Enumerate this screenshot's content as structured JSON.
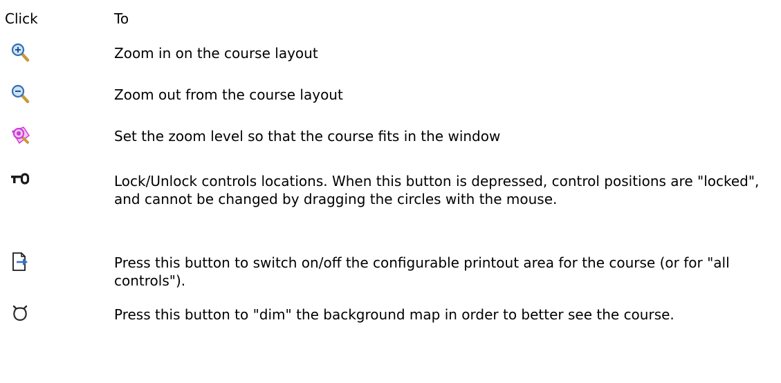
{
  "table": {
    "header_click": "Click",
    "header_to": "To"
  },
  "rows": [
    {
      "icon": "zoom-in-icon",
      "description": "Zoom in on the course layout"
    },
    {
      "icon": "zoom-out-icon",
      "description": "Zoom out from the course layout"
    },
    {
      "icon": "zoom-fit-icon",
      "description": "Set the zoom level so that the course fits in the window"
    },
    {
      "icon": "lock-controls-icon",
      "description": "Lock/Unlock controls locations.  When this button is depressed, control positions are \"locked\", and cannot be changed by dragging the circles with the mouse."
    },
    {
      "icon": "printout-area-icon",
      "description": "Press this button to switch on/off the configurable printout area for the course (or for \"all controls\")."
    },
    {
      "icon": "dim-map-icon",
      "description": "Press this button to \"dim\" the background map in order to better see the course."
    }
  ],
  "colors": {
    "magnifier_glass": "#cfe3f7",
    "magnifier_rim": "#2f6fb8",
    "magnifier_handle": "#c89a3a",
    "fit_magenta": "#d23ad8",
    "dark_icon": "#1a1a1a",
    "print_arrow": "#3a6fc4"
  }
}
